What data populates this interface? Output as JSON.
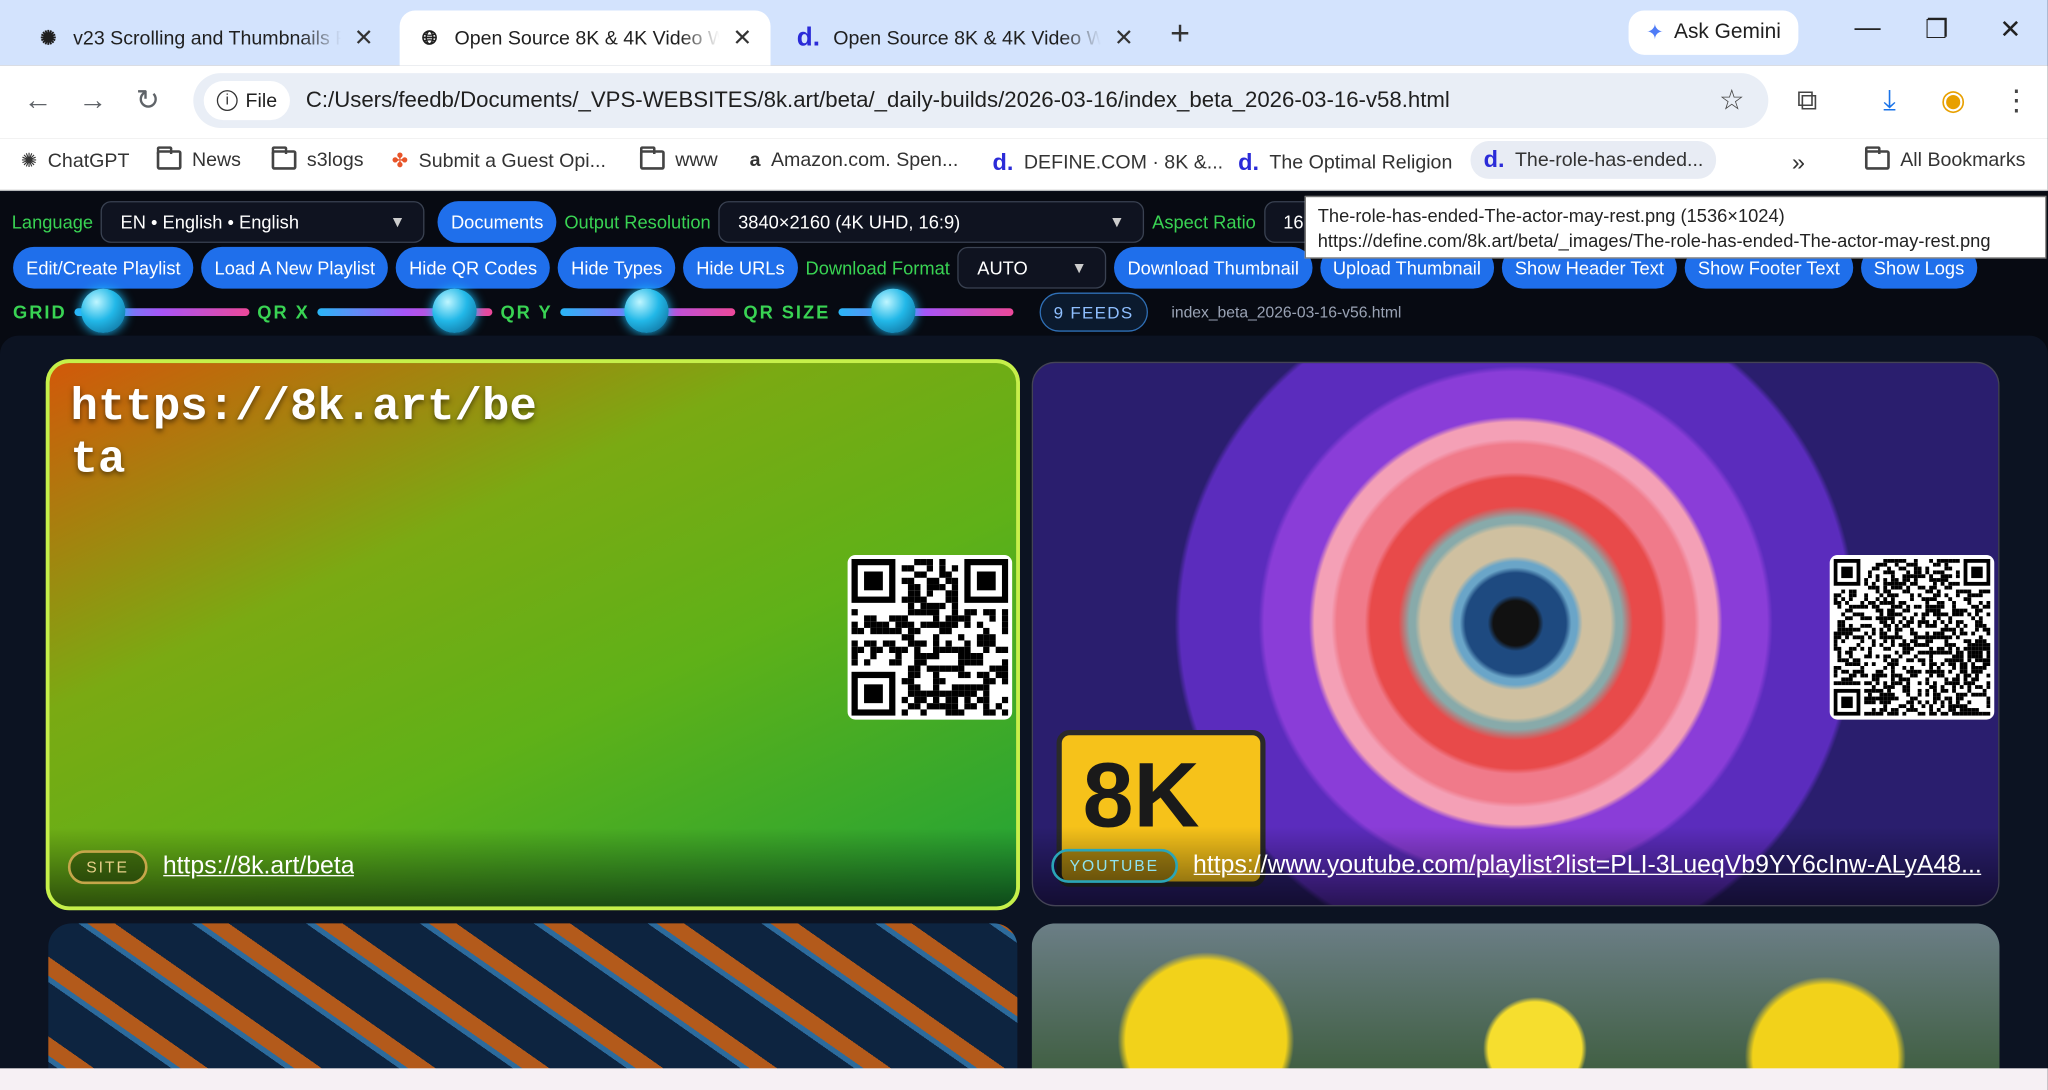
{
  "browser": {
    "tabs": [
      {
        "title": "v23 Scrolling and Thumbnails Fi",
        "favicon": "chatgpt-icon"
      },
      {
        "title": "Open Source 8K & 4K Video Wa",
        "favicon": "globe-icon",
        "active": true
      },
      {
        "title": "Open Source 8K & 4K Video Wa",
        "favicon": "define-d-icon"
      }
    ],
    "new_tab": "+",
    "ask_gemini": "Ask Gemini",
    "chip_label": "File",
    "url": "C:/Users/feedb/Documents/_VPS-WEBSITES/8k.art/beta/_daily-builds/2026-03-16/index_beta_2026-03-16-v58.html",
    "bookmarks": [
      {
        "label": "ChatGPT",
        "icon": "chatgpt-icon"
      },
      {
        "label": "News",
        "icon": "folder-icon"
      },
      {
        "label": "s3logs",
        "icon": "folder-icon"
      },
      {
        "label": "Submit a Guest Opi...",
        "icon": "pinwheel-icon"
      },
      {
        "label": "www",
        "icon": "folder-icon"
      },
      {
        "label": "Amazon.com. Spen...",
        "icon": "amazon-icon"
      },
      {
        "label": "DEFINE.COM · 8K &...",
        "icon": "define-d-icon"
      },
      {
        "label": "The Optimal Religion",
        "icon": "define-d-icon"
      },
      {
        "label": "The-role-has-ended...",
        "icon": "define-d-icon"
      }
    ],
    "more": "»",
    "all_bookmarks": "All Bookmarks"
  },
  "controls": {
    "language_label": "Language",
    "language_value": "EN • English • English",
    "documents": "Documents",
    "output_label": "Output Resolution",
    "output_value": "3840×2160 (4K UHD, 16:9)",
    "aspect_label": "Aspect Ratio",
    "aspect_value": "16×9 (vi",
    "buttons": [
      "Edit/Create Playlist",
      "Load A New Playlist",
      "Hide QR Codes",
      "Hide Types",
      "Hide URLs"
    ],
    "download_label": "Download Format",
    "download_value": "AUTO",
    "buttons2": [
      "Download Thumbnail",
      "Upload Thumbnail",
      "Show Header Text",
      "Show Footer Text",
      "Show Logs"
    ],
    "sliders": [
      {
        "label": "GRID",
        "value": 0.05
      },
      {
        "label": "QR X",
        "value": 0.88
      },
      {
        "label": "QR Y",
        "value": 0.49
      },
      {
        "label": "QR SIZE",
        "value": 0.25
      }
    ],
    "feeds": "9 FEEDS",
    "filename": "index_beta_2026-03-16-v56.html"
  },
  "tooltip": {
    "line1": "The-role-has-ended-The-actor-may-rest.png (1536×1024)",
    "line2": "https://define.com/8k.art/beta/_images/The-role-has-ended-The-actor-may-rest.png"
  },
  "cards": [
    {
      "title": "https://8k.art/beta",
      "badge": "SITE",
      "link": "https://8k.art/beta"
    },
    {
      "badge": "YOUTUBE",
      "logo": "8K",
      "link": "https://www.youtube.com/playlist?list=PLI-3LueqVb9YY6cInw-ALyA48..."
    }
  ]
}
